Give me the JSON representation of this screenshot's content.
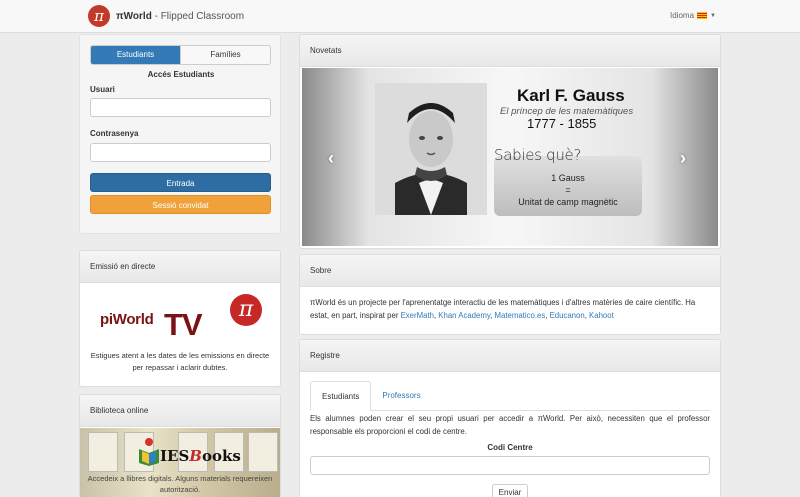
{
  "navbar": {
    "logo_glyph": "π",
    "brand_name": "πWorld",
    "brand_sep": " - ",
    "brand_tagline": "Flipped Classroom",
    "language_label": "Idioma",
    "language_flag": "catalan-flag-icon"
  },
  "login": {
    "tabs": [
      {
        "label": "Estudiants",
        "active": true
      },
      {
        "label": "Famílies",
        "active": false
      }
    ],
    "title": "Accés Estudiants",
    "username_label": "Usuari",
    "username_value": "",
    "password_label": "Contrasenya",
    "password_value": "",
    "submit_label": "Entrada",
    "guest_label": "Sessió convidat"
  },
  "emissio": {
    "heading": "Emissió en directe",
    "logo_text_1": "piWorld",
    "logo_text_2": "TV",
    "logo_glyph": "π",
    "description": "Estigues atent a les dates de les emissions en directe per repassar i aclarir dubtes."
  },
  "biblioteca": {
    "heading": "Biblioteca online",
    "logo_text_main": "IES",
    "logo_text_accent": "B",
    "logo_text_rest": "ooks",
    "description": "Accedeix a llibres digitals. Alguns materials requereixen autorització."
  },
  "novetats": {
    "heading": "Novetats",
    "slide": {
      "name": "Karl F. Gauss",
      "subtitle": "El príncep de les matemàtiques",
      "years": "1777 - 1855",
      "prompt": "Sabies què?",
      "fact_line1": "1 Gauss",
      "fact_line2": "=",
      "fact_line3": "Unitat de camp magnètic"
    },
    "prev_glyph": "‹",
    "next_glyph": "›"
  },
  "sobre": {
    "heading": "Sobre",
    "text_before": "πWorld és un projecte per l'aprenentatge interactiu de les matemàtiques i d'altres matèries de caire científic. Ha estat, en part, inspirat per ",
    "links": [
      "ExerMath",
      "Khan Academy",
      "Matematico.es",
      "Educanon",
      "Kahoot"
    ]
  },
  "registre": {
    "heading": "Registre",
    "tabs": [
      {
        "label": "Estudiants",
        "active": true
      },
      {
        "label": "Professors",
        "active": false
      }
    ],
    "text": "Els alumnes poden crear el seu propi usuari per accedir a πWorld. Per això, necessiten que el professor responsable els proporcioni el codi de centre.",
    "code_label": "Codi Centre",
    "code_value": "",
    "submit_label": "Enviar"
  },
  "colors": {
    "primary": "#337ab7",
    "orange": "#f0a23a",
    "brand_red": "#c0392b"
  }
}
